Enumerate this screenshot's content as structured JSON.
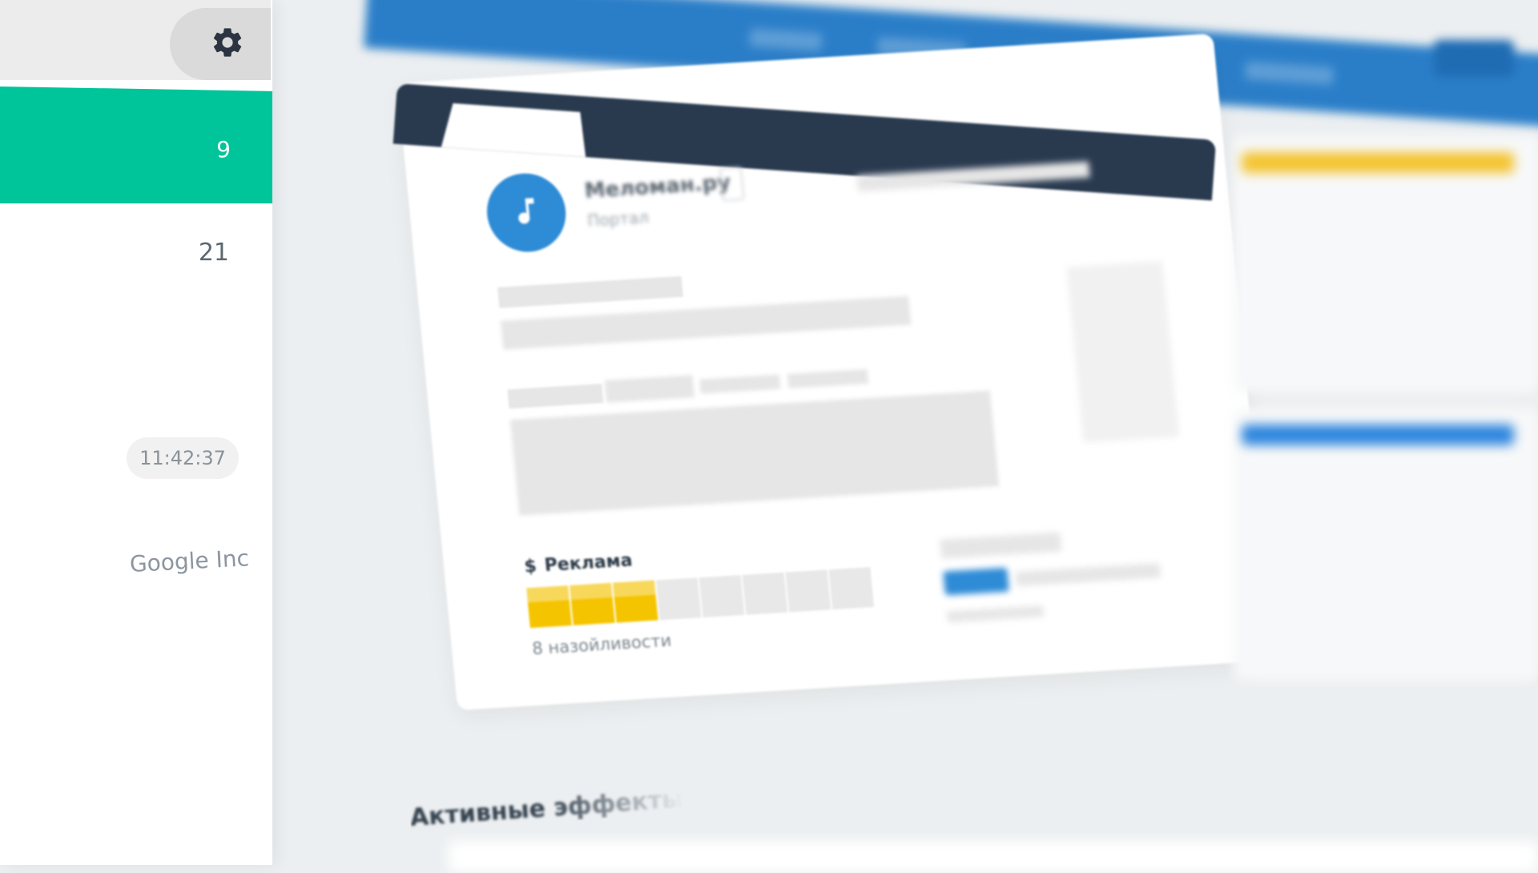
{
  "sidebar": {
    "items": [
      {
        "count": "9"
      },
      {
        "count": "21"
      }
    ],
    "time": "11:42:37",
    "company": "Google Inc"
  },
  "app": {
    "name": "Меломан.ру",
    "type": "Портал"
  },
  "ads": {
    "title": "Реклама",
    "currency_symbol": "$",
    "level": 3,
    "max_level": 8,
    "note": "8 назойливости"
  },
  "sections": {
    "active_effects": "Активные эффекты"
  },
  "colors": {
    "accent_green": "#00c49a",
    "brand_blue": "#2a7ec8",
    "header_dark": "#293a4f",
    "ad_yellow": "#f5c400"
  },
  "icons": {
    "settings": "gear-icon",
    "app": "music-note-icon"
  }
}
